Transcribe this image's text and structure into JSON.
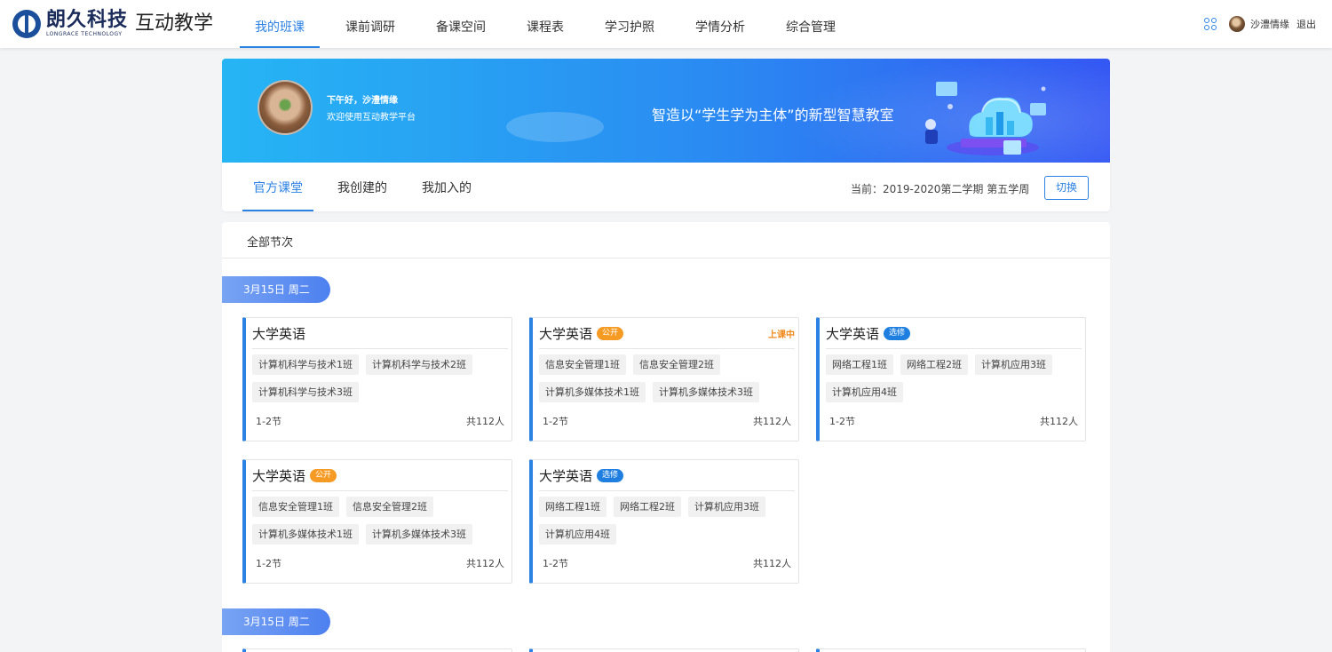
{
  "header": {
    "logo_cn": "朗久科技",
    "logo_en": "LONGRACE TECHNOLOGY",
    "app_title": "互动教学",
    "nav": [
      {
        "label": "我的班课",
        "active": true
      },
      {
        "label": "课前调研"
      },
      {
        "label": "备课空间"
      },
      {
        "label": "课程表"
      },
      {
        "label": "学习护照"
      },
      {
        "label": "学情分析"
      },
      {
        "label": "综合管理"
      }
    ],
    "username": "沙澧情缘",
    "logout": "退出"
  },
  "banner": {
    "greeting": "下午好，沙澧情缘",
    "welcome": "欢迎使用互动教学平台",
    "slogan": "智造以“学生学为主体”的新型智慧教室"
  },
  "tabs": {
    "items": [
      "官方课堂",
      "我创建的",
      "我加入的"
    ],
    "active": 0,
    "term": "当前：2019-2020第二学期 第五学周",
    "switch_label": "切换"
  },
  "panel": {
    "title": "全部节次",
    "groups": [
      {
        "date": "3月15日 周二",
        "cards": [
          {
            "name": "大学英语",
            "badge": "",
            "status": "",
            "classes": [
              "计算机科学与技术1班",
              "计算机科学与技术2班",
              "计算机科学与技术3班"
            ],
            "periods": "1-2节",
            "total": "共112人"
          },
          {
            "name": "大学英语",
            "badge": "公开",
            "status": "上课中",
            "classes": [
              "信息安全管理1班",
              "信息安全管理2班",
              "计算机多媒体技术1班",
              "计算机多媒体技术3班"
            ],
            "periods": "1-2节",
            "total": "共112人"
          },
          {
            "name": "大学英语",
            "badge": "选修",
            "status": "",
            "classes": [
              "网络工程1班",
              "网络工程2班",
              "计算机应用3班",
              "计算机应用4班"
            ],
            "periods": "1-2节",
            "total": "共112人"
          },
          {
            "name": "大学英语",
            "badge": "公开",
            "status": "",
            "classes": [
              "信息安全管理1班",
              "信息安全管理2班",
              "计算机多媒体技术1班",
              "计算机多媒体技术3班"
            ],
            "periods": "1-2节",
            "total": "共112人"
          },
          {
            "name": "大学英语",
            "badge": "选修",
            "status": "",
            "classes": [
              "网络工程1班",
              "网络工程2班",
              "计算机应用3班",
              "计算机应用4班"
            ],
            "periods": "1-2节",
            "total": "共112人"
          }
        ]
      },
      {
        "date": "3月15日 周二",
        "cards": []
      }
    ]
  },
  "colors": {
    "accent": "#2b82e3",
    "badge_public": "#f59a23",
    "badge_elective": "#1e7fe0",
    "status_live": "#f08a1c"
  }
}
